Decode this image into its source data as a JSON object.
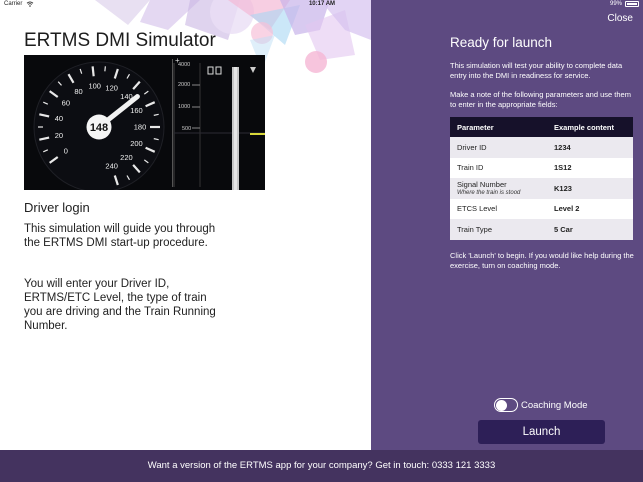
{
  "status_bar": {
    "carrier": "Carrier",
    "time": "10:17 AM",
    "battery": "99%",
    "icons": [
      "wifi-icon",
      "battery-icon"
    ]
  },
  "left": {
    "title": "ERTMS DMI Simulator",
    "dmi": {
      "speed": "148",
      "speed_value": 148,
      "dial_labels": [
        "0",
        "20",
        "40",
        "60",
        "80",
        "100",
        "120",
        "140",
        "160",
        "180",
        "200",
        "220",
        "240"
      ],
      "dial_max": 240,
      "planning_labels": [
        "4000",
        "2000",
        "1000",
        "500"
      ],
      "planning_plus": "+"
    },
    "section_title": "Driver login",
    "intro": "This simulation will guide you through the ERTMS DMI start-up procedure.",
    "detail": "You will enter your Driver ID, ERTMS/ETC Level, the type of train you are driving and the Train Running Number."
  },
  "right": {
    "close": "Close",
    "title": "Ready for launch",
    "description": "This simulation will test your ability to complete data entry into the DMI in readiness for service.",
    "note": "Make a note of the following parameters and use them to enter in the appropriate fields:",
    "table": {
      "headers": [
        "Parameter",
        "Example content"
      ],
      "rows": [
        {
          "param": "Driver ID",
          "sub": "",
          "value": "1234"
        },
        {
          "param": "Train ID",
          "sub": "",
          "value": "1S12"
        },
        {
          "param": "Signal Number",
          "sub": "Where the train is stood",
          "value": "K123"
        },
        {
          "param": "ETCS Level",
          "sub": "",
          "value": "Level 2"
        },
        {
          "param": "Train Type",
          "sub": "",
          "value": "5 Car"
        }
      ]
    },
    "footer_note": "Click 'Launch' to begin. If you would like help during the exercise, turn on coaching mode.",
    "coaching_label": "Coaching Mode",
    "coaching_on": false,
    "launch": "Launch"
  },
  "footer": "Want a version of the ERTMS app for your company? Get in touch: 0333 121 3333",
  "colors": {
    "panel": "#5d4a81",
    "footer": "#44335f",
    "button": "#2d1f57",
    "table_header": "#16112a"
  }
}
